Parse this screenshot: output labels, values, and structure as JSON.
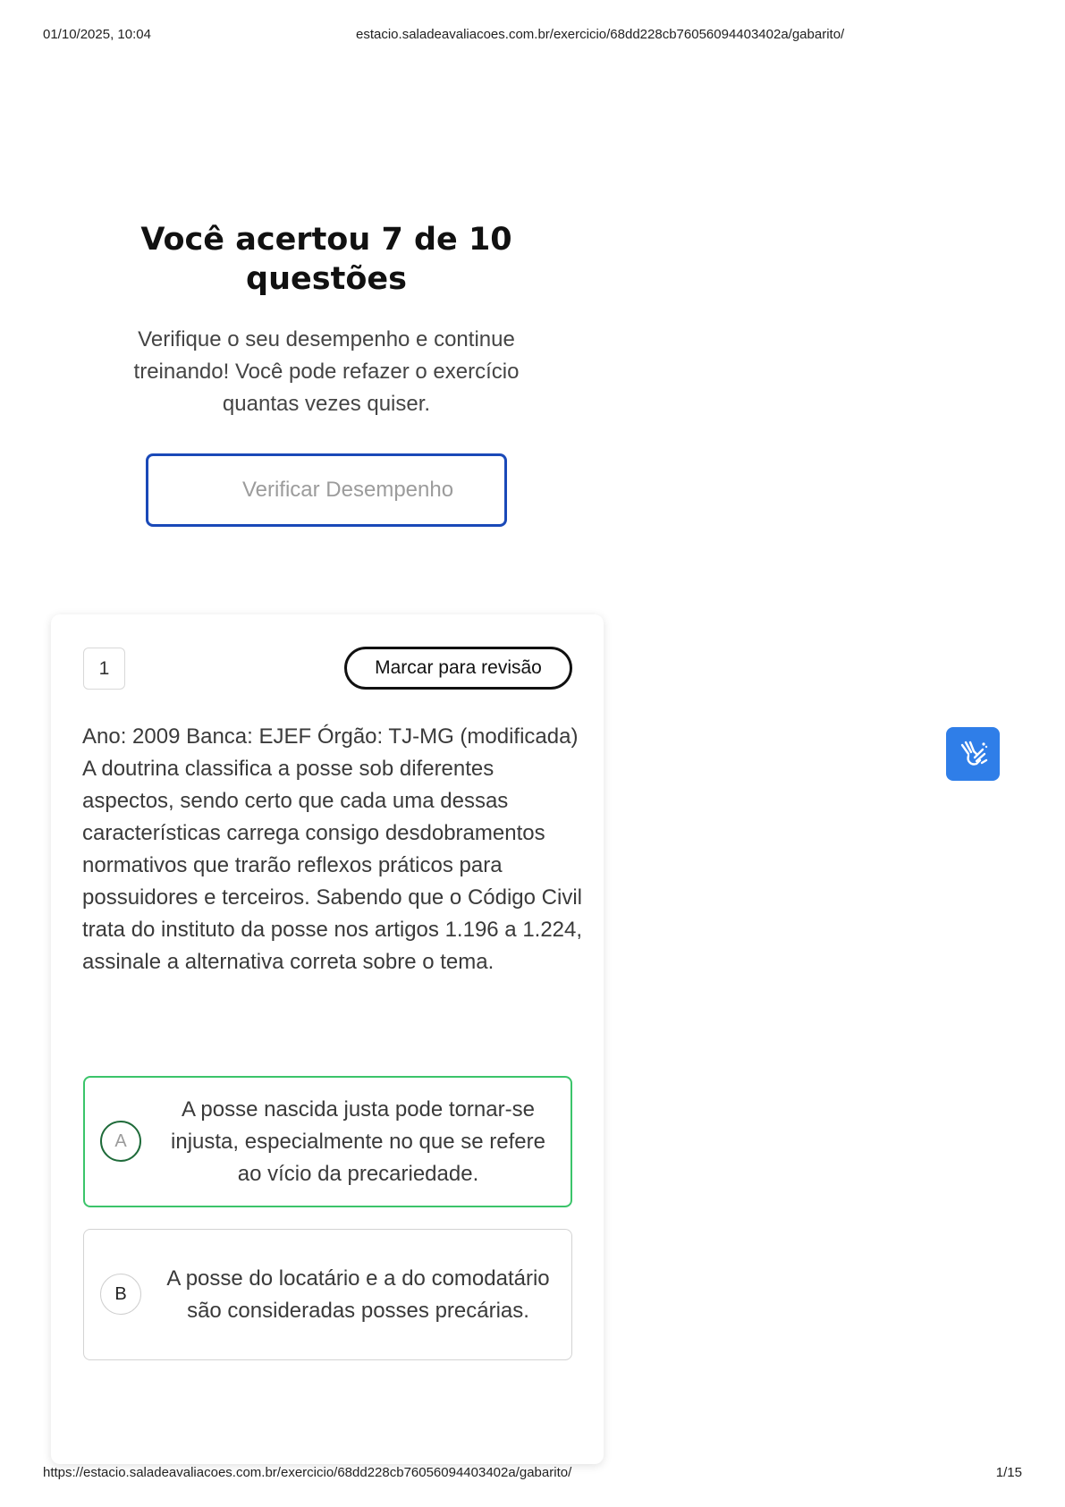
{
  "print_header": {
    "date": "01/10/2025, 10:04",
    "url": "estacio.saladeavaliacoes.com.br/exercicio/68dd228cb76056094403402a/gabarito/"
  },
  "result": {
    "title": "Você acertou 7 de 10 questões",
    "subtitle": "Verifique o seu desempenho e continue treinando! Você pode refazer o exercício quantas vezes quiser.",
    "button_label": "Verificar Desempenho"
  },
  "question": {
    "number": "1",
    "review_button_label": "Marcar para revisão",
    "source": "Ano: 2009 Banca: EJEF Órgão: TJ-MG (modificada)",
    "text": "A doutrina classifica a posse sob diferentes aspectos, sendo certo que cada uma dessas características carrega consigo desdobramentos normativos que trarão reflexos práticos para possuidores e terceiros. Sabendo que o Código Civil trata do instituto da posse nos artigos 1.196 a 1.224, assinale a alternativa correta sobre o tema.",
    "options": [
      {
        "letter": "A",
        "text": "A posse nascida justa pode tornar-se injusta, especialmente no que se refere ao vício da precariedade.",
        "state": "correct"
      },
      {
        "letter": "B",
        "text": "A posse do locatário e a do comodatário são consideradas posses precárias.",
        "state": "neutral"
      }
    ]
  },
  "libras_button": {
    "icon": "sign-language-hands-icon"
  },
  "print_footer": {
    "url": "https://estacio.saladeavaliacoes.com.br/exercicio/68dd228cb76056094403402a/gabarito/",
    "page": "1/15"
  },
  "colors": {
    "button_border": "#1a49b8",
    "correct_border": "#3bc46a",
    "libras_blue": "#2f7ee8"
  }
}
